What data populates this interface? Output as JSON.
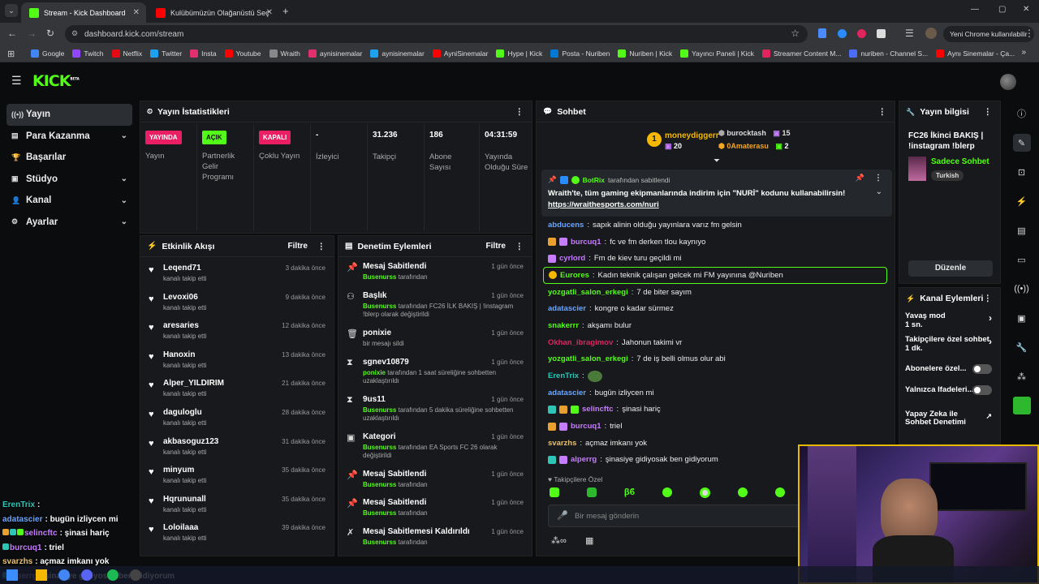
{
  "browser": {
    "tabs": [
      {
        "title": "Stream - Kick Dashboard",
        "active": true
      },
      {
        "title": "Kulübümüzün Olağanüstü Seç",
        "active": false
      }
    ],
    "url": "dashboard.kick.com/stream",
    "profile_label": "Yeni Chrome kullanılabilir",
    "bookmarks": [
      "Google",
      "Twitch",
      "Netflix",
      "Twitter",
      "Insta",
      "Youtube",
      "Wraith",
      "aynisinemalar",
      "aynisinemalar",
      "AyniSinemalar",
      "Hype | Kick",
      "Posta - Nuriben",
      "Nuriben | Kick",
      "Yayıncı Paneli | Kick",
      "Streamer Content M...",
      "nuriben - Channel S...",
      "Aynı Sinemalar - Ça..."
    ]
  },
  "kick": {
    "logo": "KICK",
    "beta": "BETA"
  },
  "sidebar": {
    "items": [
      {
        "label": "Yayın",
        "icon": "broadcast-icon",
        "active": true,
        "chevron": false
      },
      {
        "label": "Para Kazanma",
        "icon": "money-icon",
        "active": false,
        "chevron": true
      },
      {
        "label": "Başarılar",
        "icon": "trophy-icon",
        "active": false,
        "chevron": false
      },
      {
        "label": "Stüdyo",
        "icon": "studio-icon",
        "active": false,
        "chevron": true
      },
      {
        "label": "Kanal",
        "icon": "user-icon",
        "active": false,
        "chevron": true
      },
      {
        "label": "Ayarlar",
        "icon": "gear-icon",
        "active": false,
        "chevron": true
      }
    ]
  },
  "stats": {
    "title": "Yayın İstatistikleri",
    "cells": [
      {
        "badge": "YAYINDA",
        "badge_color": "#e91e63",
        "label": "Yayın"
      },
      {
        "badge": "AÇIK",
        "badge_color": "#53fc18",
        "label": "Partnerlik Gelir Programı"
      },
      {
        "badge": "KAPALI",
        "badge_color": "#e91e63",
        "label": "Çoklu Yayın"
      },
      {
        "value": "-",
        "label": "İzleyici"
      },
      {
        "value": "31.236",
        "label": "Takipçi"
      },
      {
        "value": "186",
        "label": "Abone Sayısı"
      },
      {
        "value": "04:31:59",
        "label": "Yayında Olduğu Süre"
      }
    ]
  },
  "activity": {
    "title": "Etkinlik Akışı",
    "filter": "Filtre",
    "items": [
      {
        "name": "Leqend71",
        "sub": "kanalı takip etti",
        "time": "3 dakika önce"
      },
      {
        "name": "Levoxi06",
        "sub": "kanalı takip etti",
        "time": "9 dakika önce"
      },
      {
        "name": "aresaries",
        "sub": "kanalı takip etti",
        "time": "12 dakika önce"
      },
      {
        "name": "Hanoxin",
        "sub": "kanalı takip etti",
        "time": "13 dakika önce"
      },
      {
        "name": "Alper_YILDIRIM",
        "sub": "kanalı takip etti",
        "time": "21 dakika önce"
      },
      {
        "name": "daguloglu",
        "sub": "kanalı takip etti",
        "time": "28 dakika önce"
      },
      {
        "name": "akbasoguz123",
        "sub": "kanalı takip etti",
        "time": "31 dakika önce"
      },
      {
        "name": "minyum",
        "sub": "kanalı takip etti",
        "time": "35 dakika önce"
      },
      {
        "name": "Hqrununall",
        "sub": "kanalı takip etti",
        "time": "35 dakika önce"
      },
      {
        "name": "Loloilaaa",
        "sub": "kanalı takip etti",
        "time": "39 dakika önce"
      }
    ]
  },
  "moderation": {
    "title": "Denetim Eylemleri",
    "filter": "Filtre",
    "items": [
      {
        "icon": "pin-icon",
        "name": "Mesaj Sabitlendi",
        "actor": "Busenurss",
        "rest": "tarafından",
        "time": "1 gün önce"
      },
      {
        "icon": "title-icon",
        "name": "Başlık",
        "actor": "Busenurss",
        "rest": "tarafından FC26 İLK BAKIŞ | !instagram !blerp olarak değiştirildi",
        "time": "1 gün önce"
      },
      {
        "icon": "trash-icon",
        "name": "ponixie",
        "actor": "",
        "rest": "bir mesajı sildi",
        "time": "1 gün önce"
      },
      {
        "icon": "hourglass-icon",
        "name": "sgnev10879",
        "actor": "ponixie",
        "rest": "tarafından 1 saat süreliğine sohbetten uzaklaştırıldı",
        "time": "1 gün önce"
      },
      {
        "icon": "hourglass-icon",
        "name": "9us11",
        "actor": "Busenurss",
        "rest": "tarafından 5 dakika süreliğine sohbetten uzaklaştırıldı",
        "time": "1 gün önce"
      },
      {
        "icon": "category-icon",
        "name": "Kategori",
        "actor": "Busenurss",
        "rest": "tarafından EA Sports FC 26 olarak değiştirildi",
        "time": "1 gün önce"
      },
      {
        "icon": "pin-icon",
        "name": "Mesaj Sabitlendi",
        "actor": "Busenurss",
        "rest": "tarafından",
        "time": "1 gün önce"
      },
      {
        "icon": "pin-icon",
        "name": "Mesaj Sabitlendi",
        "actor": "Busenurss",
        "rest": "tarafından",
        "time": "1 gün önce"
      },
      {
        "icon": "unpin-icon",
        "name": "Mesaj Sabitlemesi Kaldırıldı",
        "actor": "Busenurss",
        "rest": "tarafından",
        "time": "1 gün önce"
      }
    ]
  },
  "chat": {
    "title": "Sohbet",
    "top_gifters": [
      {
        "rank": "1",
        "name": "moneydiggerr",
        "count": "20"
      },
      {
        "name": "burocktash",
        "count": "15"
      },
      {
        "name": "0Amaterasu",
        "count": "2"
      }
    ],
    "pinned": {
      "user": "BotRix",
      "by": "tarafından sabitlendi",
      "text": "Wraith'te, tüm gaming ekipmanlarında indirim için \"NURİ\" kodunu kullanabilirsin!",
      "link": "https://wraithesports.com/nuri"
    },
    "messages": [
      {
        "user": "abducens",
        "color": "#6aa4ff",
        "text": "sapık alinin olduğu yayınlara varız fm gelsin"
      },
      {
        "user": "burcuq1",
        "color": "#c77dff",
        "text": "fc ve fm derken tlou kaynıyo"
      },
      {
        "user": "cyrlord",
        "color": "#c77dff",
        "text": "Fm de kiev turu geçildi mi"
      },
      {
        "user": "Eurores",
        "color": "#53fc18",
        "text": "Kadın teknik çalışan gelcek mi FM yayınına @Nuriben",
        "highlight": true
      },
      {
        "user": "yozgatli_salon_erkegi",
        "color": "#53fc18",
        "text": "7 de biter sayım"
      },
      {
        "user": "adatascier",
        "color": "#6aa4ff",
        "text": "kongre o kadar sürmez"
      },
      {
        "user": "snakerrr",
        "color": "#53fc18",
        "text": "akşamı bulur"
      },
      {
        "user": "Okhan_ibragimov",
        "color": "#e0245e",
        "text": "Jahonun takimi vr"
      },
      {
        "user": "yozgatli_salon_erkegi",
        "color": "#53fc18",
        "text": "7 de iş belli olmus olur abi"
      },
      {
        "user": "ErenTrix",
        "color": "#2ec4b6",
        "text": ""
      },
      {
        "user": "adatascier",
        "color": "#6aa4ff",
        "text": "bugün izliycen mi"
      },
      {
        "user": "selincftc",
        "color": "#c77dff",
        "text": "şinasi hariç"
      },
      {
        "user": "burcuq1",
        "color": "#c77dff",
        "text": "triel"
      },
      {
        "user": "svarzhs",
        "color": "#e8c070",
        "text": "açmaz imkanı yok"
      },
      {
        "user": "alperrg",
        "color": "#c77dff",
        "text": "şinasiye gidiyosak ben gidiyorum"
      }
    ],
    "followers_only": "Takipçilere Özel",
    "placeholder": "Bir mesaj gönderin"
  },
  "info": {
    "title": "Yayın bilgisi",
    "stream_title": "FC26 İkinci BAKIŞ | !instagram !blerp",
    "chat_mode": "Sadece Sohbet",
    "language": "Turkish",
    "edit": "Düzenle"
  },
  "channel_actions": {
    "title": "Kanal Eylemleri",
    "items": [
      {
        "label": "Yavaş mod",
        "value": "1 sn.",
        "control": "chevron"
      },
      {
        "label": "Takipçilere özel sohbet",
        "value": "1 dk.",
        "control": "chevron"
      },
      {
        "label": "Abonelere özel...",
        "value": "",
        "control": "toggle"
      },
      {
        "label": "Yalnızca İfadeleri...",
        "value": "",
        "control": "toggle"
      },
      {
        "label": "Yapay Zeka ile Sohbet Denetimi",
        "value": "",
        "control": "external"
      }
    ]
  },
  "overlay": {
    "lines": [
      {
        "user": "ErenTrix",
        "color": "#2ec4b6",
        "text": ":"
      },
      {
        "user": "adatascier",
        "color": "#6aa4ff",
        "text": ": bugün izliycen mi"
      },
      {
        "user": "selincftc",
        "color": "#c77dff",
        "text": ": şinasi hariç"
      },
      {
        "user": "burcuq1",
        "color": "#c77dff",
        "text": ": triel"
      },
      {
        "user": "svarzhs",
        "color": "#e8c070",
        "text": ": açmaz imkanı yok"
      },
      {
        "user": "alperrg",
        "color": "#c77dff",
        "text": ": şinasiye gidiyosak ben gidiyorum"
      }
    ]
  }
}
